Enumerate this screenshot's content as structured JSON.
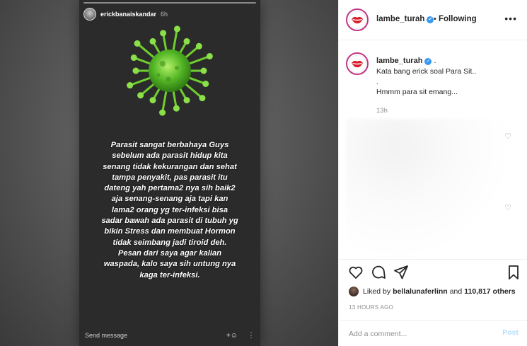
{
  "story": {
    "username": "erickbanaiskandar",
    "time": "6h",
    "text_lines": [
      "Parasit sangat berbahaya Guys",
      "sebelum ada parasit hidup kita",
      "senang tidak kekurangan dan sehat",
      "tampa penyakit, pas parasit itu",
      "dateng yah pertama2 nya sih baik2",
      "aja senang-senang aja tapi kan",
      "lama2 orang yg ter-infeksi bisa",
      "sadar bawah ada parasit di tubuh yg",
      "bikin Stress dan membuat Hormon",
      "tidak seimbang jadi tiroid deh.",
      "Pesan dari saya agar kalian",
      "waspada, kalo saya sih untung nya",
      "kaga ter-infeksi."
    ],
    "send_message": "Send message",
    "icons": [
      "add-person-icon",
      "more-vertical-icon",
      "virus-image"
    ]
  },
  "header": {
    "username": "lambe_turah",
    "separator": "•",
    "follow_status": "Following",
    "more": "•••"
  },
  "caption": {
    "username": "lambe_turah",
    "suffix": ".",
    "lines": [
      "Kata bang erick soal Para Sit..",
      ".",
      "Hmmm para sit emang..."
    ],
    "time": "13h"
  },
  "likes": {
    "prefix": "Liked by",
    "user": "bellalunaferlinn",
    "and": "and",
    "others": "110,817 others"
  },
  "posted_ago": "13 HOURS AGO",
  "comment": {
    "placeholder": "Add a comment...",
    "post_label": "Post"
  },
  "colors": {
    "verified": "#3897f0",
    "ring": "#c13584",
    "post_disabled": "#b2dffc",
    "virus_green": "#4caf2a"
  }
}
